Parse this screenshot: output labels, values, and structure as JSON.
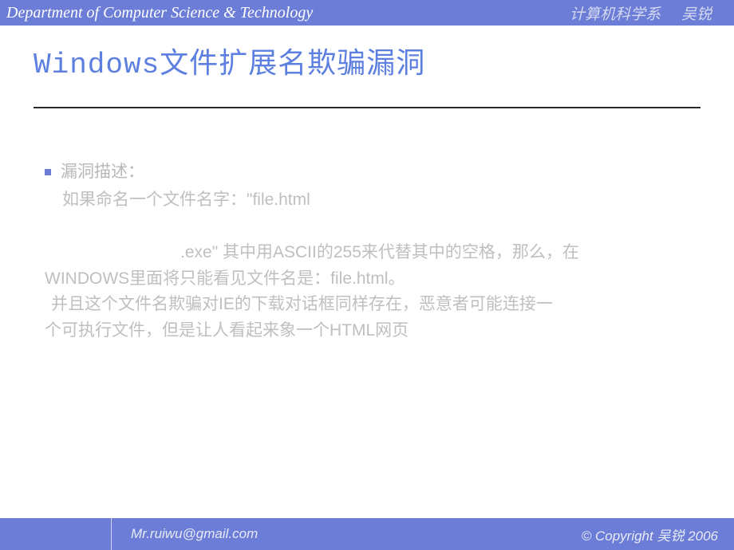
{
  "header": {
    "department_en": "Department of Computer Science & Technology",
    "department_cn": "计算机科学系",
    "author": "吴锐"
  },
  "slide": {
    "title": "Windows文件扩展名欺骗漏洞",
    "bullet_heading": "漏洞描述：",
    "line1": "如果命名一个文件名字：\"file.html",
    "line2": ".exe\" 其中用ASCII的255来代替其中的空格，那么，在",
    "line3": "WINDOWS里面将只能看见文件名是：file.html。",
    "line4": "并且这个文件名欺骗对IE的下载对话框同样存在，恶意者可能连接一",
    "line5": "个可执行文件，但是让人看起来象一个HTML网页"
  },
  "footer": {
    "email": "Mr.ruiwu@gmail.com",
    "copyright": "© Copyright  吴锐 2006"
  }
}
